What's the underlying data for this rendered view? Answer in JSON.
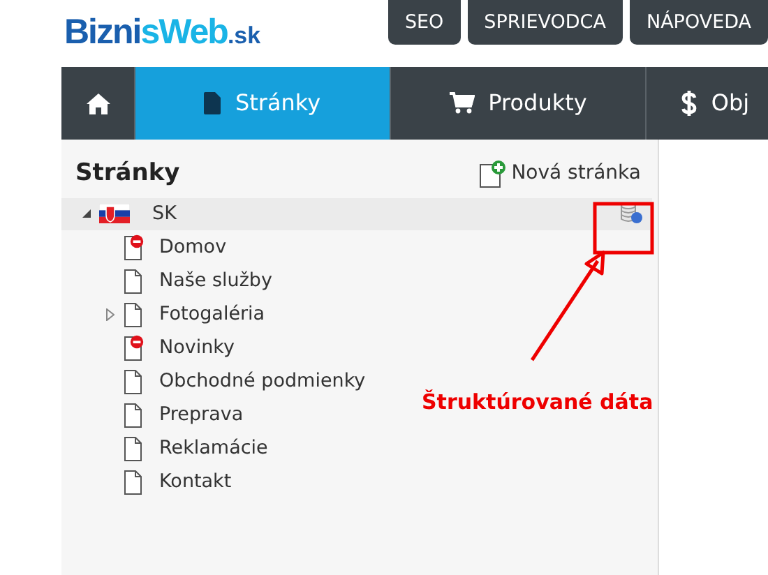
{
  "logo": {
    "name": "BiznisWeb",
    "suffix": ".sk"
  },
  "top_links": [
    "SEO",
    "SPRIEVODCA",
    "NÁPOVEDA"
  ],
  "nav": [
    {
      "kind": "home",
      "selected": false
    },
    {
      "kind": "pages",
      "label": "Stránky",
      "selected": true
    },
    {
      "kind": "products",
      "label": "Produkty",
      "selected": false
    },
    {
      "kind": "orders",
      "label": "Obj",
      "selected": false
    }
  ],
  "panel": {
    "title": "Stránky",
    "new_page": "Nová stránka"
  },
  "tree": [
    {
      "label": "SK",
      "expanded": true,
      "children": [
        {
          "label": "Domov",
          "restricted": true,
          "expandable": false
        },
        {
          "label": "Naše služby",
          "restricted": false,
          "expandable": false
        },
        {
          "label": "Fotogaléria",
          "restricted": false,
          "expandable": true
        },
        {
          "label": "Novinky",
          "restricted": true,
          "expandable": false
        },
        {
          "label": "Obchodné podmienky",
          "restricted": false,
          "expandable": false
        },
        {
          "label": "Preprava",
          "restricted": false,
          "expandable": false
        },
        {
          "label": "Reklamácie",
          "restricted": false,
          "expandable": false
        },
        {
          "label": "Kontakt",
          "restricted": false,
          "expandable": false
        }
      ]
    }
  ],
  "annotation": {
    "label": "Štruktúrované dáta"
  }
}
